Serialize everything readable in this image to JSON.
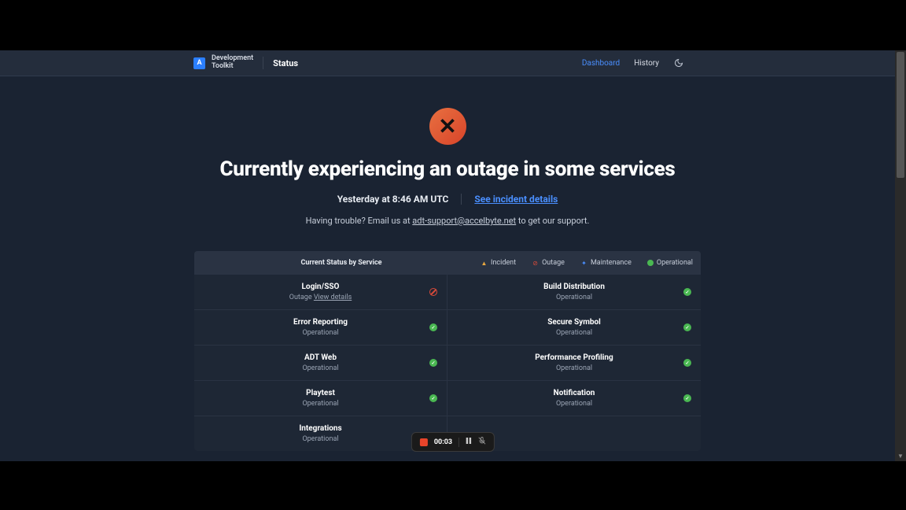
{
  "header": {
    "logo_abbrev": "A",
    "logo_text_line1": "Development",
    "logo_text_line2": "Toolkit",
    "status_label": "Status",
    "nav": {
      "dashboard": "Dashboard",
      "history": "History"
    }
  },
  "hero": {
    "headline": "Currently experiencing an outage in some services",
    "timestamp": "Yesterday at 8:46 AM UTC",
    "incident_link": "See incident details",
    "support_prefix": "Having trouble? Email us at ",
    "support_email": "adt-support@accelbyte.net",
    "support_suffix": " to get our support."
  },
  "panel": {
    "title": "Current Status by Service",
    "legend": {
      "incident": "Incident",
      "outage": "Outage",
      "maintenance": "Maintenance",
      "operational": "Operational"
    }
  },
  "services": {
    "left": [
      {
        "name": "Login/SSO",
        "status": "Outage",
        "detail_link": "View details",
        "icon": "outage"
      },
      {
        "name": "Error Reporting",
        "status": "Operational",
        "icon": "operational"
      },
      {
        "name": "ADT Web",
        "status": "Operational",
        "icon": "operational"
      },
      {
        "name": "Playtest",
        "status": "Operational",
        "icon": "operational"
      },
      {
        "name": "Integrations",
        "status": "Operational",
        "icon": "operational"
      }
    ],
    "right": [
      {
        "name": "Build Distribution",
        "status": "Operational",
        "icon": "operational"
      },
      {
        "name": "Secure Symbol",
        "status": "Operational",
        "icon": "operational"
      },
      {
        "name": "Performance Profiling",
        "status": "Operational",
        "icon": "operational"
      },
      {
        "name": "Notification",
        "status": "Operational",
        "icon": "operational"
      }
    ]
  },
  "recorder": {
    "time": "00:03"
  },
  "colors": {
    "outage": "#d84a3a",
    "incident": "#e8a840",
    "maintenance": "#4a8fff",
    "operational": "#4ab852",
    "accent": "#4a8fff"
  }
}
